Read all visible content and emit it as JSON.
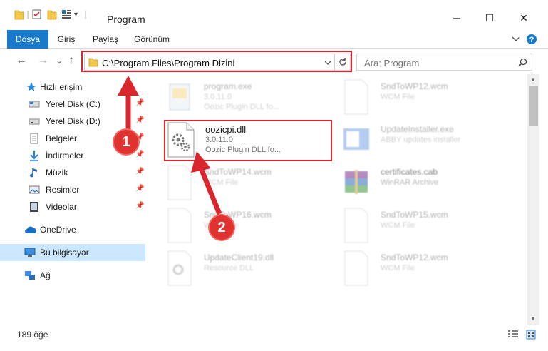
{
  "window": {
    "title": "Program",
    "minimize": "─",
    "maximize": "☐",
    "close": "✕"
  },
  "ribbon": {
    "tabs": [
      {
        "label": "Dosya",
        "active": true
      },
      {
        "label": "Giriş",
        "active": false
      },
      {
        "label": "Paylaş",
        "active": false
      },
      {
        "label": "Görünüm",
        "active": false
      }
    ],
    "expand_icon": "chevron-down-icon",
    "help_icon": "help-icon"
  },
  "navigation": {
    "back": "←",
    "forward": "→",
    "dropdown": "⌄",
    "up": "↑",
    "address": "C:\\Program Files\\Program Dizini",
    "search_placeholder": "Ara: Program"
  },
  "sidebar": {
    "items": [
      {
        "label": "Hızlı erişim",
        "icon": "star-icon",
        "pinned": false
      },
      {
        "label": "Yerel Disk (C:)",
        "icon": "drive-icon",
        "pinned": true
      },
      {
        "label": "Yerel Disk (D:)",
        "icon": "drive-icon",
        "pinned": true
      },
      {
        "label": "Belgeler",
        "icon": "documents-icon",
        "pinned": true
      },
      {
        "label": "İndirmeler",
        "icon": "download-icon",
        "pinned": true
      },
      {
        "label": "Müzik",
        "icon": "music-icon",
        "pinned": true
      },
      {
        "label": "Resimler",
        "icon": "pictures-icon",
        "pinned": true
      },
      {
        "label": "Videolar",
        "icon": "video-icon",
        "pinned": true
      },
      {
        "label": "OneDrive",
        "icon": "cloud-icon",
        "pinned": false
      },
      {
        "label": "Bu bilgisayar",
        "icon": "computer-icon",
        "pinned": false
      },
      {
        "label": "Ağ",
        "icon": "network-icon",
        "pinned": false
      }
    ]
  },
  "files": [
    {
      "name": "program.exe",
      "line1": "3.0.11.0",
      "line2": "Oozic Plugin DLL fo...",
      "icon": "exe-icon"
    },
    {
      "name": "SndToWP12.wcm",
      "line1": "WCM File",
      "line2": "",
      "icon": "document-icon"
    },
    {
      "name": "oozicpi.dll",
      "line1": "3.0.11.0",
      "line2": "Oozic Plugin DLL fo...",
      "icon": "dll-gear-icon"
    },
    {
      "name": "UpdateInstaller.exe",
      "line1": "ABBY updates installer",
      "line2": "",
      "icon": "installer-icon"
    },
    {
      "name": "SndToWP14.wcm",
      "line1": "WCM File",
      "line2": "",
      "icon": "document-icon"
    },
    {
      "name": "certificates.cab",
      "line1": "WinRAR Archive",
      "line2": "",
      "icon": "archive-icon"
    },
    {
      "name": "SndToWP16.wcm",
      "line1": "WCM File",
      "line2": "",
      "icon": "document-icon"
    },
    {
      "name": "SndToWP15.wcm",
      "line1": "WCM File",
      "line2": "",
      "icon": "document-icon"
    },
    {
      "name": "UpdateClient19.dll",
      "line1": "Resource DLL",
      "line2": "",
      "icon": "dll-gear-icon"
    },
    {
      "name": "SndToWP12.wcm",
      "line1": "WCM File",
      "line2": "",
      "icon": "document-icon"
    }
  ],
  "annotations": {
    "step1": "1",
    "step2": "2",
    "color": "#d9262c"
  },
  "status": {
    "count": "189 öğe"
  }
}
